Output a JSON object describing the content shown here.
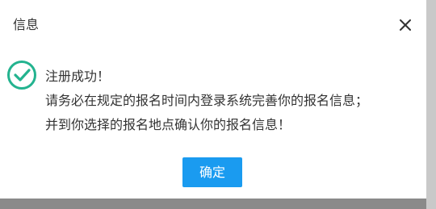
{
  "dialog": {
    "title": "信息",
    "close_icon": "close-icon",
    "status_icon": "success-check-circle-icon",
    "messages": [
      "注册成功！",
      "请务必在规定的报名时间内登录系统完善你的报名信息；",
      "并到你选择的报名地点确认你的报名信息！"
    ],
    "confirm_label": "确定"
  },
  "colors": {
    "accent": "#1a9bf0",
    "success": "#23b38f",
    "text": "#333333",
    "overlay": "#8a8a8a"
  }
}
